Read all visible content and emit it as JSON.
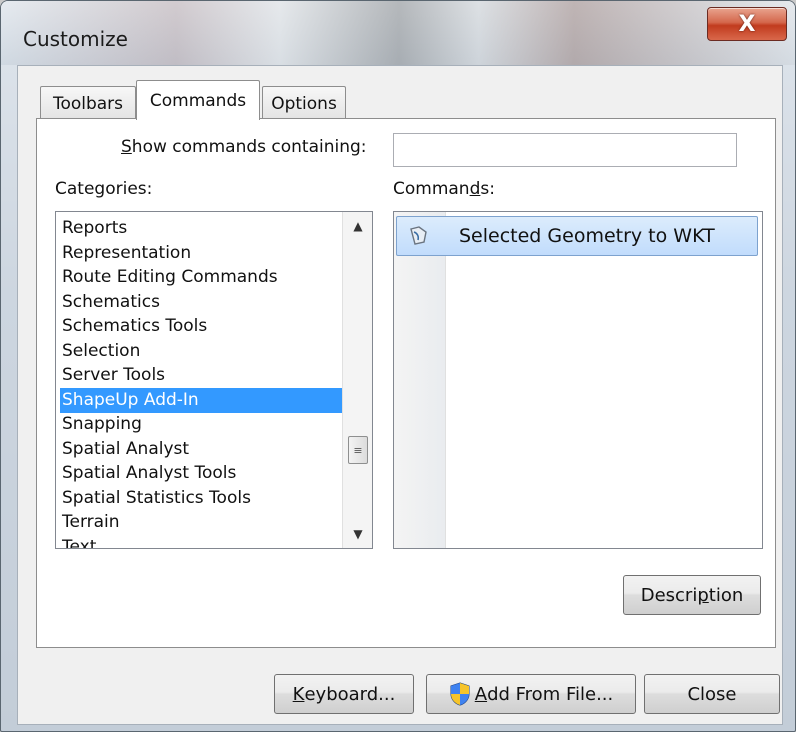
{
  "window": {
    "title": "Customize",
    "close_glyph": "X"
  },
  "tabs": [
    {
      "label": "Toolbars",
      "active": false
    },
    {
      "label": "Commands",
      "active": true
    },
    {
      "label": "Options",
      "active": false
    }
  ],
  "search": {
    "label_prefix": "",
    "label_mnemonic": "S",
    "label_rest": "how commands containing:",
    "value": ""
  },
  "categories": {
    "label": "Categories:",
    "items": [
      "Reports",
      "Representation",
      "Route Editing Commands",
      "Schematics",
      "Schematics Tools",
      "Selection",
      "Server Tools",
      "ShapeUp Add-In",
      "Snapping",
      "Spatial Analyst",
      "Spatial Analyst Tools",
      "Spatial Statistics Tools",
      "Terrain",
      "Text"
    ],
    "selected": "ShapeUp Add-In",
    "scroll_up_glyph": "▲",
    "scroll_down_glyph": "▼",
    "thumb_glyph": "≡"
  },
  "commands": {
    "label_prefix": "Comman",
    "label_mnemonic": "d",
    "label_rest": "s:",
    "items": [
      {
        "label": "Selected Geometry to WKT",
        "icon": "geometry-tool-icon"
      }
    ]
  },
  "buttons": {
    "description": {
      "prefix": "Descri",
      "mnemonic": "p",
      "rest": "tion"
    },
    "keyboard": {
      "prefix": "",
      "mnemonic": "K",
      "rest": "eyboard..."
    },
    "add_from_file": {
      "prefix": "",
      "mnemonic": "A",
      "rest": "dd From File...",
      "icon": "uac-shield-icon"
    },
    "close": {
      "label": "Close"
    }
  }
}
